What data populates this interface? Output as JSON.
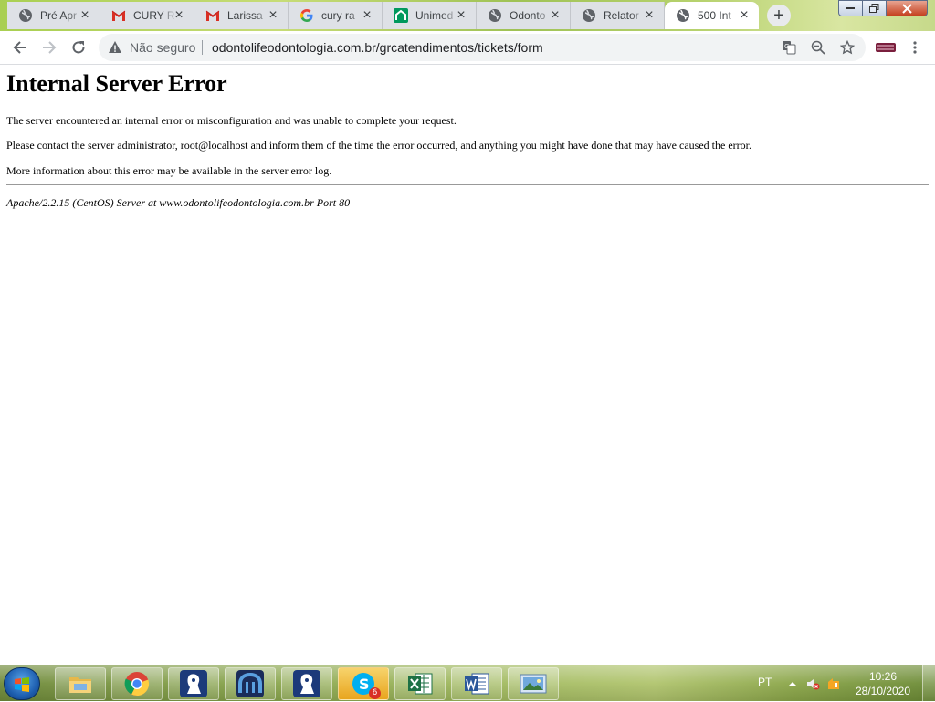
{
  "browser": {
    "tabs": [
      {
        "label": "Pré Apr",
        "icon": "globe-icon"
      },
      {
        "label": "CURY R",
        "icon": "gmail-icon"
      },
      {
        "label": "Larissa",
        "icon": "gmail-icon"
      },
      {
        "label": "cury ra",
        "icon": "google-icon"
      },
      {
        "label": "Unimed",
        "icon": "unimed-icon"
      },
      {
        "label": "Odonto",
        "icon": "globe-icon"
      },
      {
        "label": "Relator",
        "icon": "globe-icon"
      },
      {
        "label": "500 Int",
        "icon": "globe-icon",
        "active": true
      }
    ],
    "security_label": "Não seguro",
    "url": "odontolifeodontologia.com.br/grcatendimentos/tickets/form"
  },
  "page": {
    "title": "Internal Server Error",
    "paragraphs": [
      "The server encountered an internal error or misconfiguration and was unable to complete your request.",
      "Please contact the server administrator, root@localhost and inform them of the time the error occurred, and anything you might have done that may have caused the error.",
      "More information about this error may be available in the server error log."
    ],
    "footer": "Apache/2.2.15 (CentOS) Server at www.odontolifeodontologia.com.br Port 80"
  },
  "taskbar": {
    "apps": [
      "chrome-icon",
      "file-explorer-icon",
      "app-figure-icon",
      "app-arch-icon",
      "app-figure-icon",
      "skype-icon",
      "excel-icon",
      "word-icon",
      "photo-viewer-icon"
    ],
    "skype_badge": "6",
    "language": "PT",
    "time": "10:26",
    "date": "28/10/2020"
  },
  "colors": {
    "tab_inactive": "#dee1e6",
    "tab_active": "#ffffff",
    "omnibox": "#f1f3f4",
    "gmail_red": "#d93025",
    "unimed_green": "#00995d",
    "taskbar_green": "#86a24a"
  }
}
